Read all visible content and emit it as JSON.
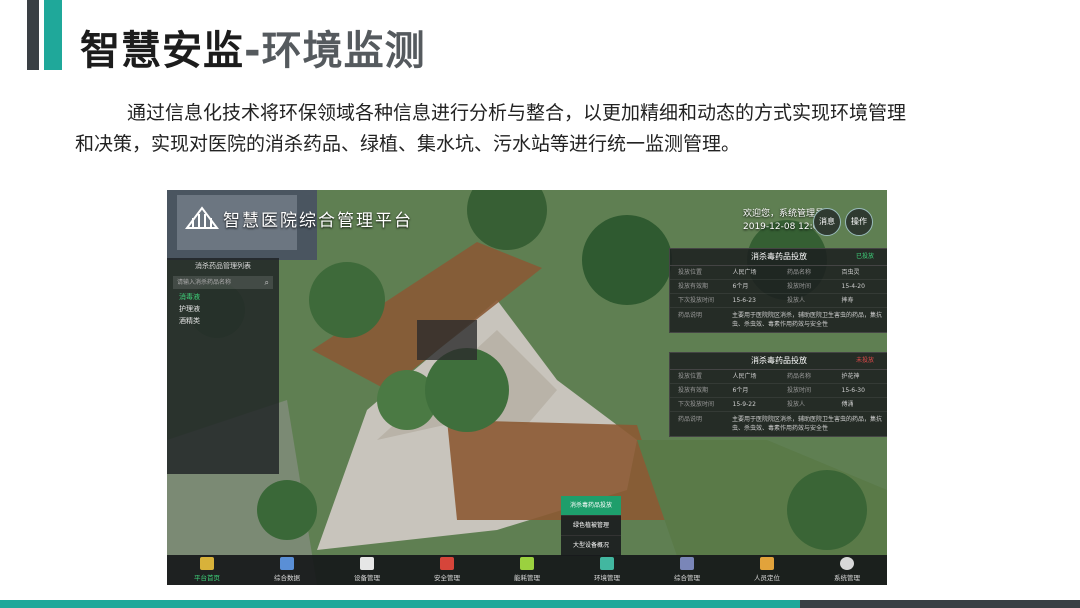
{
  "slide": {
    "title_main": "智慧安监",
    "title_dash": "-",
    "title_sub": "环境监测",
    "paragraph_line1": "通过信息化技术将环保领域各种信息进行分析与整合，以更加精细和动态的方式实现环境管理",
    "paragraph_line2": "和决策，实现对医院的消杀药品、绿植、集水坑、污水站等进行统一监测管理。"
  },
  "app": {
    "title": "智慧医院综合管理平台",
    "welcome_line1": "欢迎您，系统管理员",
    "welcome_line2": "2019-12-08 12:00",
    "btn_messages": "消息",
    "btn_operate": "操作"
  },
  "left_panel": {
    "title": "消杀药品管理列表",
    "search_placeholder": "请输入消杀药品名称",
    "items": [
      "消毒液",
      "护理液",
      "酒精类"
    ]
  },
  "panel_top": {
    "title": "消杀毒药品投放",
    "badge": "已投放",
    "rows": [
      [
        "投放位置",
        "人民广场",
        "药品名称",
        "百虫灵"
      ],
      [
        "投放有效期",
        "6个月",
        "投放时间",
        "15-4-20"
      ],
      [
        "下次投放时间",
        "15-6-23",
        "投放人",
        "摔寿"
      ]
    ],
    "desc_label": "药品说明",
    "desc_text": "主要用于医院院区消杀，辅助医院卫生害虫的药品，集抗虫、杀虫效、毒素作用药效与安全性"
  },
  "panel_bottom": {
    "title": "消杀毒药品投放",
    "badge": "未投放",
    "rows": [
      [
        "投放位置",
        "人民广场",
        "药品名称",
        "护花神"
      ],
      [
        "投放有效期",
        "6个月",
        "投放时间",
        "15-6-30"
      ],
      [
        "下次投放时间",
        "15-9-22",
        "投放人",
        "傅涌"
      ]
    ],
    "desc_label": "药品说明",
    "desc_text": "主要用于医院院区消杀，辅助医院卫生害虫的药品，集抗虫、杀虫效、毒素作用药效与安全性"
  },
  "popup_menu": [
    "消杀毒药品投放",
    "绿色植被管理",
    "大型设备概况"
  ],
  "bottom_nav": [
    {
      "label": "平台首页",
      "icon": "platform-home-icon",
      "color": "#d8b23a"
    },
    {
      "label": "综合数据",
      "icon": "data-icon",
      "color": "#5a8fd6"
    },
    {
      "label": "设备管理",
      "icon": "device-icon",
      "color": "#e6e6e6"
    },
    {
      "label": "安全管理",
      "icon": "security-icon",
      "color": "#d6453a"
    },
    {
      "label": "能耗管理",
      "icon": "energy-icon",
      "color": "#9bd13f"
    },
    {
      "label": "环境管理",
      "icon": "environment-icon",
      "color": "#42b7a0"
    },
    {
      "label": "综合管理",
      "icon": "monitor-icon",
      "color": "#7a86b8"
    },
    {
      "label": "人员定位",
      "icon": "map-icon",
      "color": "#e2a33b"
    },
    {
      "label": "系统管理",
      "icon": "gear-icon",
      "color": "#d8d8d8"
    }
  ],
  "colors": {
    "accent_teal": "#1fa89a",
    "dark_bar": "#3a3f44",
    "active_green": "#3fd27a"
  }
}
